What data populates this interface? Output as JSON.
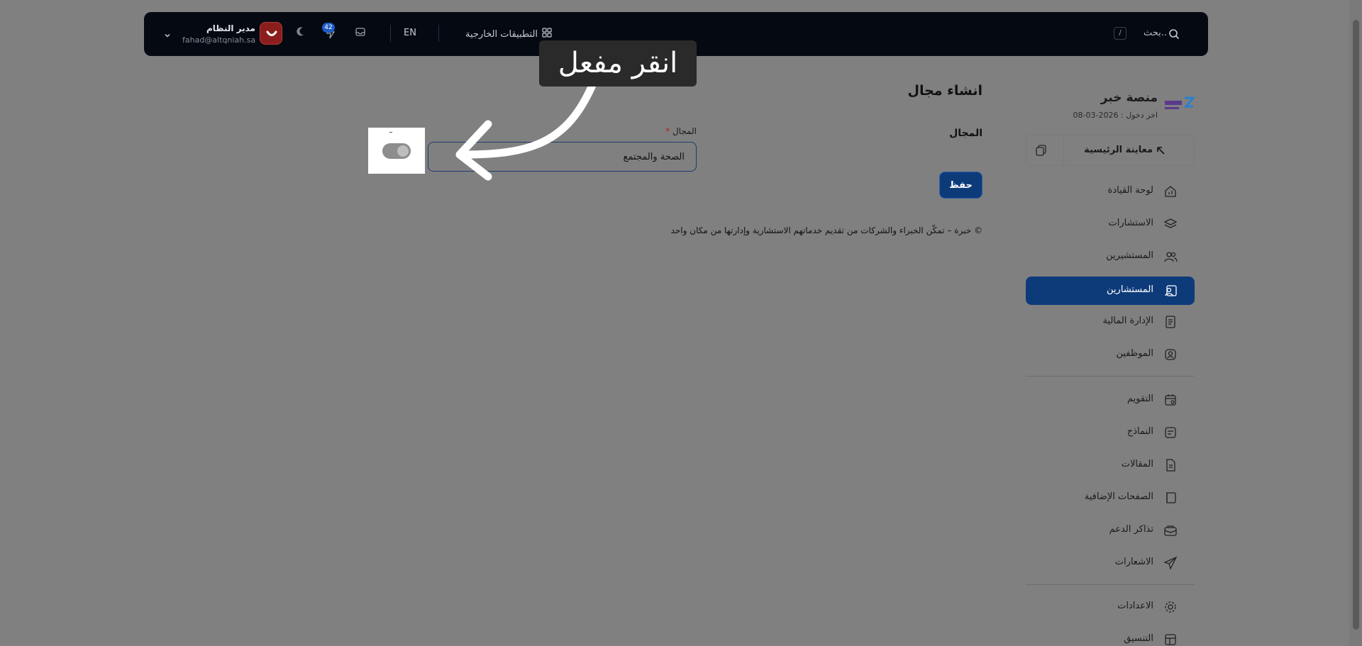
{
  "topbar": {
    "search_label": "بحث..",
    "search_shortcut": "/",
    "external_apps_label": "التطبيقات الخارجية",
    "language": "EN",
    "notifications_count": "42",
    "user_name": "مدير النظام",
    "user_email": "fahad@altqniah.sa"
  },
  "sidebar": {
    "brand_title": "منصة خبر",
    "brand_subtitle": "اخر دخول : 2026-03-08",
    "home_label": "معاينة الرئيسية",
    "items": [
      {
        "label": "لوحة القيادة",
        "icon": "home-chart-icon"
      },
      {
        "label": "الاستشارات",
        "icon": "layers-icon"
      },
      {
        "label": "المستشيرين",
        "icon": "users-icon"
      },
      {
        "label": "المستشارين",
        "icon": "user-card-icon",
        "active": true
      },
      {
        "label": "الإدارة المالية",
        "icon": "receipt-icon"
      },
      {
        "label": "الموظفين",
        "icon": "user-circle-icon"
      },
      {
        "label": "التقويم",
        "icon": "calendar-icon"
      },
      {
        "label": "النماذج",
        "icon": "form-icon"
      },
      {
        "label": "المقالات",
        "icon": "document-icon"
      },
      {
        "label": "الصفحات الإضافية",
        "icon": "page-icon"
      },
      {
        "label": "تذاكر الدعم",
        "icon": "ticket-icon"
      },
      {
        "label": "الاشعارات",
        "icon": "send-icon"
      },
      {
        "label": "الاعدادات",
        "icon": "gear-icon"
      },
      {
        "label": "التنسيق",
        "icon": "layout-icon"
      }
    ]
  },
  "main": {
    "page_title": "انشاء مجال",
    "section_label": "المجال",
    "field_label": "المجال",
    "field_required": "*",
    "field_value": "الصحة والمجتمع",
    "save_label": "حفظ",
    "footer": "© خبرة – تمكّن الخبراء والشركات من تقديم خدماتهم الاستشارية وإدارتها من مكان واحد"
  },
  "annotation": {
    "text": "انقر مفعل"
  },
  "colors": {
    "overlay": "#808080",
    "topbar": "#050a12",
    "accent": "#0d3b7a",
    "avatar": "#8b1d1d",
    "badge": "#1f5cc8"
  }
}
